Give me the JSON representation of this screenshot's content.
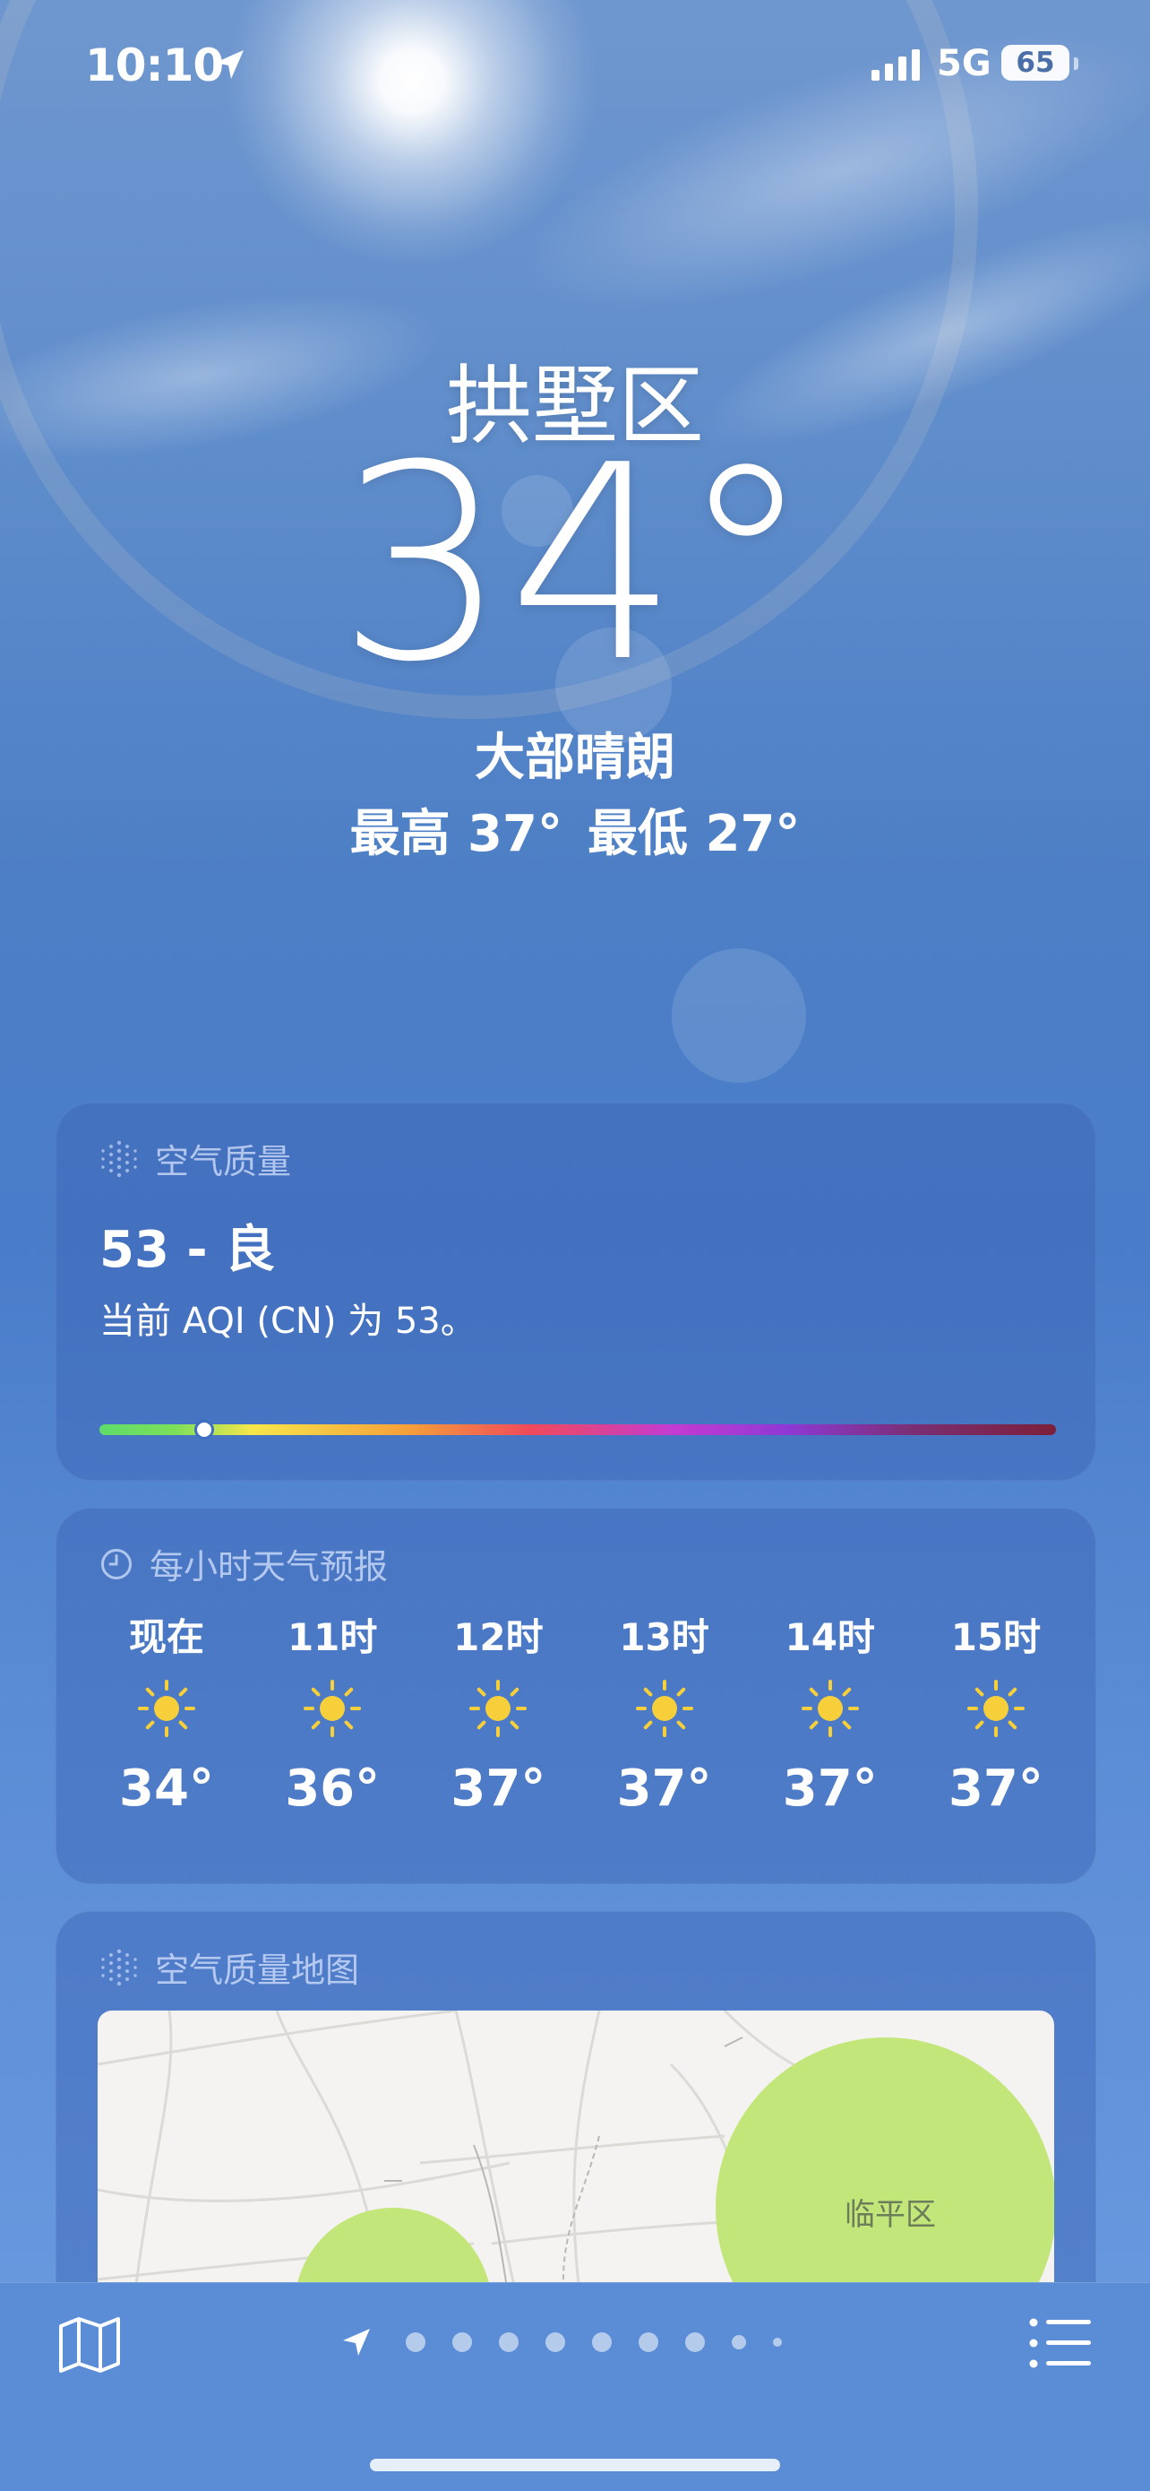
{
  "status_bar": {
    "time": "10:10",
    "network": "5G",
    "battery": "65"
  },
  "current": {
    "city": "拱墅区",
    "temperature": "34°",
    "condition": "大部晴朗",
    "high": "最高 37°",
    "low": "最低 27°"
  },
  "air_quality": {
    "title": "空气质量",
    "value": "53 - 良",
    "description": "当前 AQI (CN) 为 53。",
    "level": 0.11
  },
  "hourly": {
    "title": "每小时天气预报",
    "items": [
      {
        "label": "现在",
        "icon": "sun-icon",
        "temp": "34°"
      },
      {
        "label": "11时",
        "icon": "sun-icon",
        "temp": "36°"
      },
      {
        "label": "12时",
        "icon": "sun-icon",
        "temp": "37°"
      },
      {
        "label": "13时",
        "icon": "sun-icon",
        "temp": "37°"
      },
      {
        "label": "14时",
        "icon": "sun-icon",
        "temp": "37°"
      },
      {
        "label": "15时",
        "icon": "sun-icon",
        "temp": "37°"
      }
    ]
  },
  "aqi_map": {
    "title": "空气质量地图",
    "label": "临平区"
  },
  "toolbar": {
    "left_icon": "map-icon",
    "right_icon": "list-icon",
    "page_dots": 9
  },
  "colors": {
    "sun": "#f7cf3a",
    "card_bg": "#3c64b4",
    "map_zone": "#c3e67a"
  }
}
